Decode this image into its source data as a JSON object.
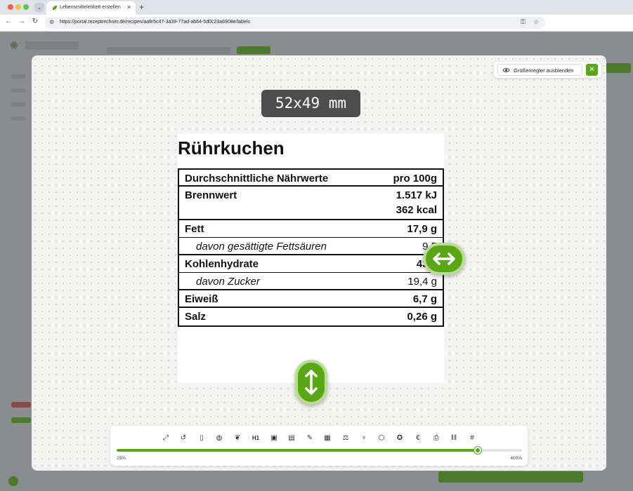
{
  "browser": {
    "tab_title": "Lebensmitteletikett erstellen",
    "url": "https://portal.rezeptrechner.de/recipes/aafe5c47-3a39-77ad-ab64-5d0c23a6908e/labels"
  },
  "modal": {
    "hide_size_controls_label": "Größenregler ausblenden",
    "size_badge": "52x49 mm"
  },
  "label": {
    "title": "Rührkuchen",
    "header": {
      "name": "Durchschnittliche Nährwerte",
      "value": "pro 100g"
    },
    "rows": [
      {
        "name": "Brennwert",
        "value": "1.517 kJ",
        "value2": "362 kcal"
      },
      {
        "name": "Fett",
        "value": "17,9 g"
      },
      {
        "name": "davon gesättigte Fettsäuren",
        "value": "9,5"
      },
      {
        "name": "Kohlenhydrate",
        "value": "43,0"
      },
      {
        "name": "davon Zucker",
        "value": "19,4 g"
      },
      {
        "name": "Eiweiß",
        "value": "6,7 g"
      },
      {
        "name": "Salz",
        "value": "0,26 g"
      }
    ]
  },
  "zoom": {
    "min_label": "25%",
    "max_label": "400%",
    "fraction": 0.89
  },
  "toolbar_icons": [
    "expand-icon",
    "reset-icon",
    "portrait-icon",
    "palette-icon",
    "leaf-icon",
    "heading-icon",
    "image-icon",
    "table-icon",
    "pen-icon",
    "calendar-icon",
    "scale-icon",
    "wine-icon",
    "package-icon",
    "certificate-icon",
    "euro-icon",
    "printer-icon",
    "barcode-icon",
    "hashtag-icon"
  ],
  "colors": {
    "accent": "#5aa617",
    "accent_light": "#b9dc92",
    "badge_bg": "#4d4d4d"
  }
}
